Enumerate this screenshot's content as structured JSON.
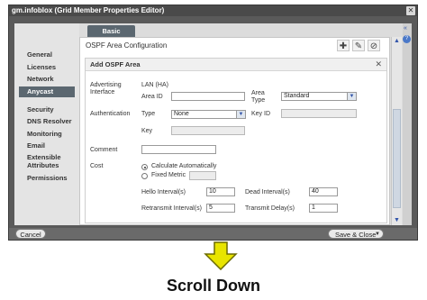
{
  "window": {
    "title": "gm.infoblox (Grid Member Properties Editor)",
    "close_icon": "close-icon"
  },
  "tabs": [
    {
      "label": "Basic"
    }
  ],
  "sidebar": {
    "items": [
      {
        "label": "General"
      },
      {
        "label": "Licenses"
      },
      {
        "label": "Network"
      },
      {
        "label": "Anycast",
        "active": true
      },
      {
        "label": "Security"
      },
      {
        "label": "DNS Resolver"
      },
      {
        "label": "Monitoring"
      },
      {
        "label": "Email"
      },
      {
        "label": "Extensible Attributes"
      },
      {
        "label": "Permissions"
      }
    ]
  },
  "panel": {
    "title": "OSPF Area Configuration",
    "toolbar": [
      "add-icon",
      "edit-icon",
      "delete-icon"
    ]
  },
  "dialog": {
    "title": "Add OSPF Area",
    "advertising_interface_label": "Advertising Interface",
    "advertising_interface_value": "LAN (HA)",
    "area_id_label": "Area ID",
    "area_id_value": "",
    "area_type_label": "Area Type",
    "area_type_value": "Standard",
    "authentication_label": "Authentication",
    "type_label": "Type",
    "type_value": "None",
    "key_id_label": "Key ID",
    "key_label": "Key",
    "comment_label": "Comment",
    "cost_label": "Cost",
    "cost_options": [
      "Calculate Automatically",
      "Fixed Metric"
    ],
    "hello_interval_label": "Hello Interval(s)",
    "hello_interval_value": "10",
    "dead_interval_label": "Dead Interval(s)",
    "dead_interval_value": "40",
    "retransmit_interval_label": "Retransmit Interval(s)",
    "retransmit_interval_value": "5",
    "transmit_delay_label": "Transmit Delay(s)",
    "transmit_delay_value": "1"
  },
  "footer": {
    "cancel_label": "Cancel",
    "save_label": "Save & Close"
  },
  "caption": "Scroll Down",
  "colors": {
    "arrow_fill": "#e8e400",
    "arrow_stroke": "#6b6a00",
    "active_nav": "#5b6770"
  }
}
